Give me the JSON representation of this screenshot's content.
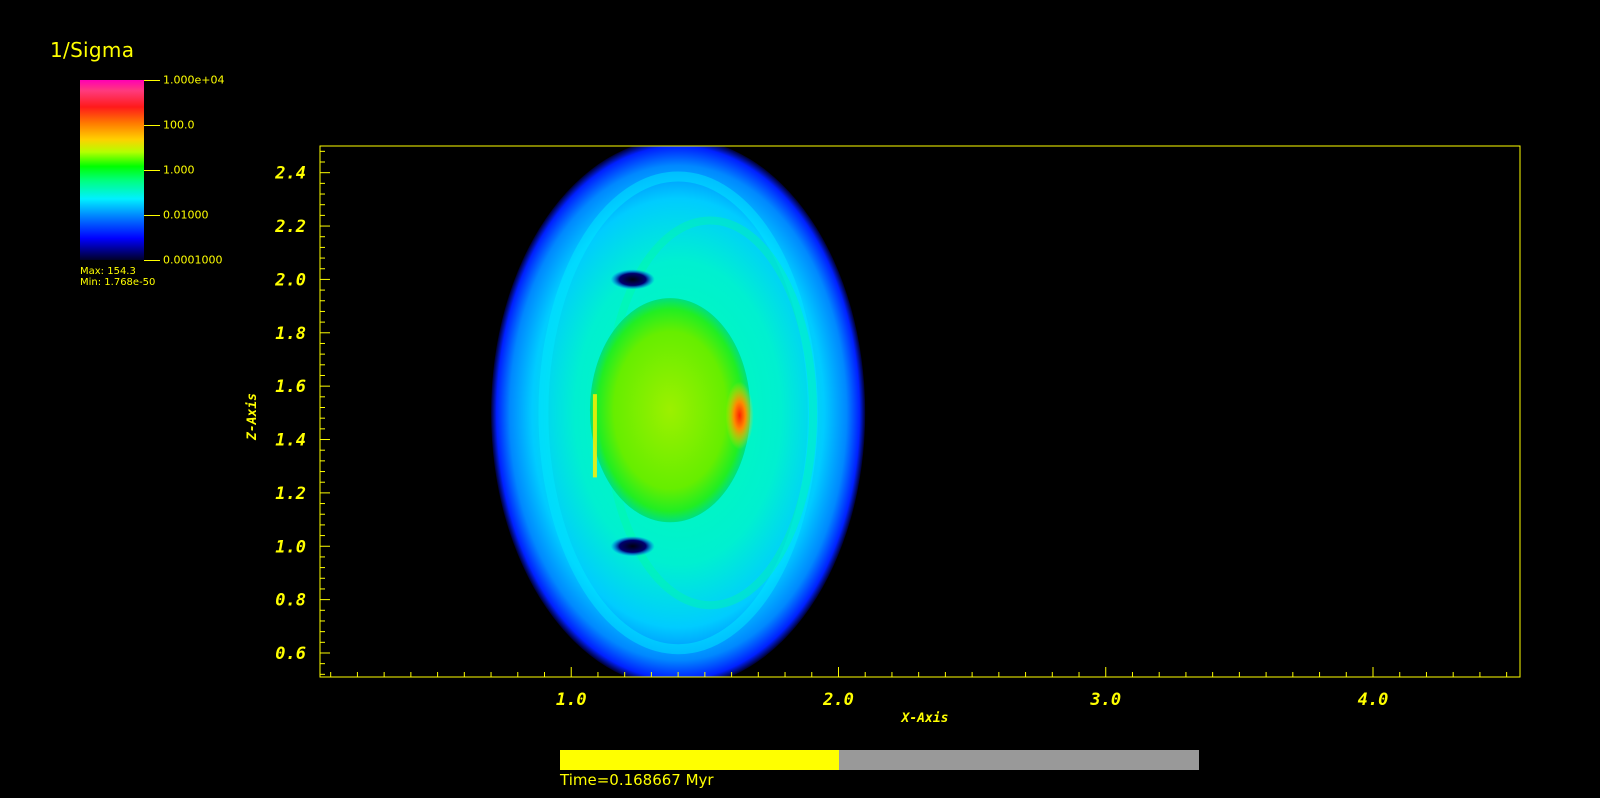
{
  "legend": {
    "title": "1/Sigma",
    "ticks": [
      "1.000e+04",
      "100.0",
      "1.000",
      "0.01000",
      "0.0001000"
    ],
    "max_label": "Max:  154.3",
    "min_label": "Min:  1.768e-50"
  },
  "time": {
    "label": "Time=0.168667 Myr",
    "progress": 0.437
  },
  "colors": {
    "background": "#000000",
    "axis": "#ffff00",
    "time_track": "#999999",
    "time_fill": "#ffff00"
  },
  "chart_data": {
    "type": "heatmap",
    "field": "1/Sigma",
    "scale": "log",
    "color_range": [
      0.0001,
      10000
    ],
    "xlabel": "X-Axis",
    "ylabel": "Z-Axis",
    "xlim": [
      0.06,
      4.55
    ],
    "ylim": [
      0.51,
      2.5
    ],
    "x_ticks": [
      1.0,
      2.0,
      3.0,
      4.0
    ],
    "x_tick_labels": [
      "1.0",
      "2.0",
      "3.0",
      "4.0"
    ],
    "y_ticks": [
      0.6,
      0.8,
      1.0,
      1.2,
      1.4,
      1.6,
      1.8,
      2.0,
      2.2,
      2.4
    ],
    "y_tick_labels": [
      "0.6",
      "0.8",
      "1.0",
      "1.2",
      "1.4",
      "1.6",
      "1.8",
      "2.0",
      "2.2",
      "2.4"
    ],
    "x_minor_step": 0.1,
    "y_minor_step": 0.04,
    "features": [
      {
        "kind": "outer_shell",
        "cx": 1.4,
        "cz": 1.5,
        "rx": 0.7,
        "rz": 1.03,
        "value": 0.01
      },
      {
        "kind": "inner_core",
        "cx": 1.37,
        "cz": 1.51,
        "rx": 0.3,
        "rz": 0.42,
        "value": 1.0
      },
      {
        "kind": "hotspot",
        "x": 1.63,
        "z": 1.49,
        "value": 100.0
      },
      {
        "kind": "dark_knot",
        "x": 1.23,
        "z": 2.0,
        "value": 0.001
      },
      {
        "kind": "dark_knot",
        "x": 1.23,
        "z": 1.0,
        "value": 0.001
      }
    ]
  }
}
